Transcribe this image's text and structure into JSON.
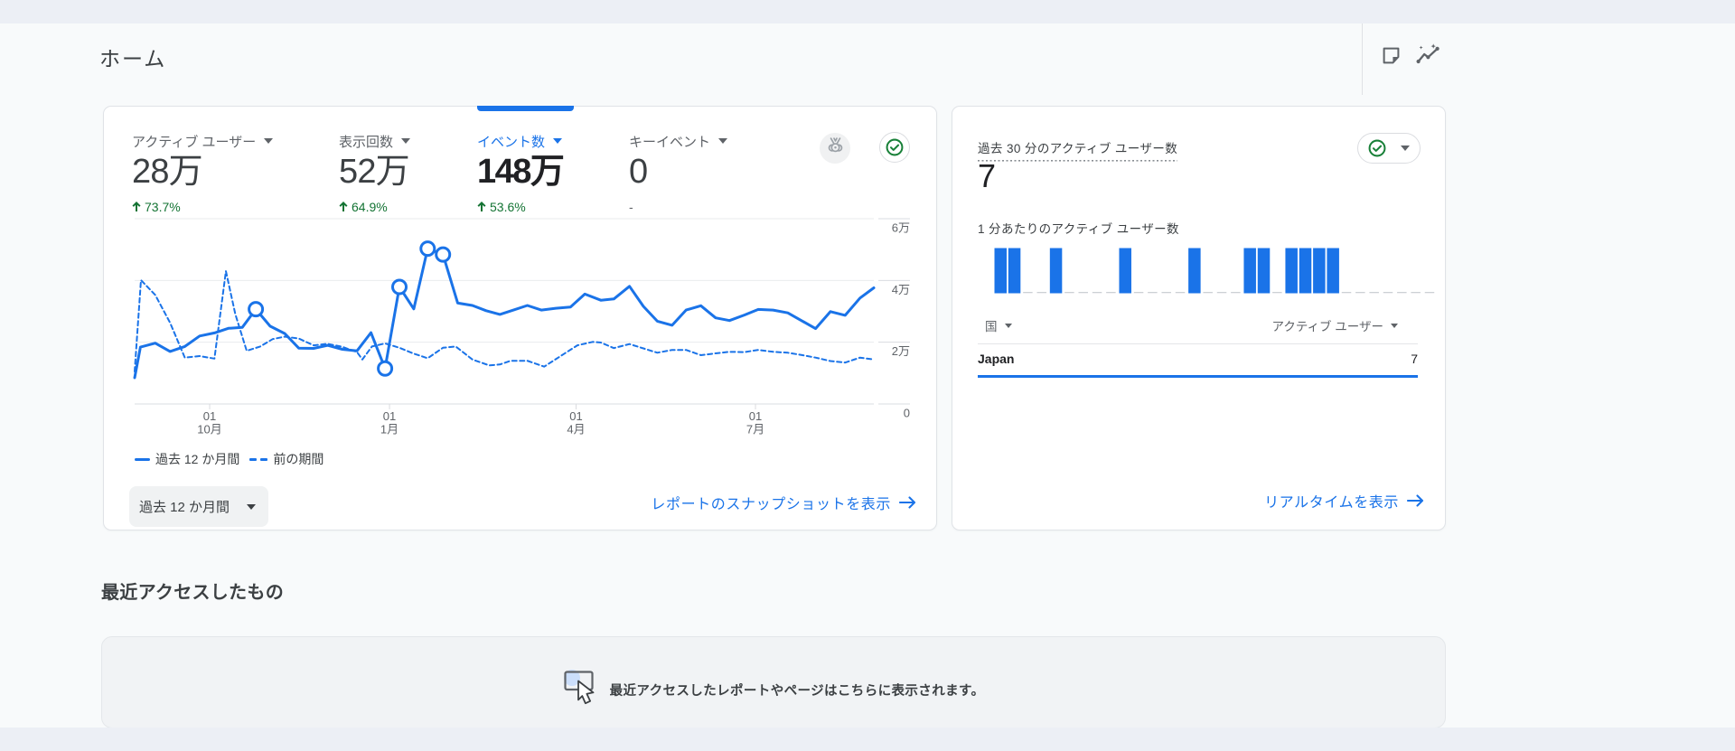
{
  "page": {
    "title": "ホーム"
  },
  "header": {
    "icons": [
      {
        "name": "note-icon"
      },
      {
        "name": "insights-icon"
      }
    ]
  },
  "overview_card": {
    "metrics": [
      {
        "label": "アクティブ ユーザー",
        "value": "28万",
        "delta": "73.7%",
        "delta_dir": "up",
        "selected": false
      },
      {
        "label": "表示回数",
        "value": "52万",
        "delta": "64.9%",
        "delta_dir": "up",
        "selected": false
      },
      {
        "label": "イベント数",
        "value": "148万",
        "delta": "53.6%",
        "delta_dir": "up",
        "selected": true
      },
      {
        "label": "キーイベント",
        "value": "0",
        "delta": "-",
        "delta_dir": "none",
        "selected": false
      }
    ],
    "legend": [
      {
        "label": "過去 12 か月間",
        "style": "solid"
      },
      {
        "label": "前の期間",
        "style": "dashed"
      }
    ],
    "range_button_label": "過去 12 か月間",
    "link_label": "レポートのスナップショットを表示",
    "chart_data": {
      "type": "line",
      "unit": "万",
      "ylim": [
        0,
        6
      ],
      "y_ticks": [
        {
          "value": 6,
          "label": "6万"
        },
        {
          "value": 4,
          "label": "4万"
        },
        {
          "value": 2,
          "label": "2万"
        },
        {
          "value": 0,
          "label": "0"
        }
      ],
      "x_ticks": [
        {
          "frac": 0.1015,
          "line1": "01",
          "line2": "10月"
        },
        {
          "frac": 0.3448,
          "line1": "01",
          "line2": "1月"
        },
        {
          "frac": 0.5972,
          "line1": "01",
          "line2": "4月"
        },
        {
          "frac": 0.8399,
          "line1": "01",
          "line2": "7月"
        }
      ],
      "series": [
        {
          "name": "過去 12 か月間",
          "style": "solid",
          "points": [
            [
              0.0,
              0.85
            ],
            [
              0.0078,
              1.84
            ],
            [
              0.0279,
              1.97
            ],
            [
              0.0479,
              1.7
            ],
            [
              0.0678,
              1.86
            ],
            [
              0.0879,
              2.2
            ],
            [
              0.108,
              2.3
            ],
            [
              0.1268,
              2.45
            ],
            [
              0.1456,
              2.48
            ],
            [
              0.1639,
              3.07
            ],
            [
              0.1832,
              2.52
            ],
            [
              0.2032,
              2.28
            ],
            [
              0.222,
              1.81
            ],
            [
              0.2421,
              1.8
            ],
            [
              0.2609,
              1.9
            ],
            [
              0.2809,
              1.77
            ],
            [
              0.3009,
              1.72
            ],
            [
              0.3197,
              2.31
            ],
            [
              0.3388,
              1.15
            ],
            [
              0.3582,
              3.79
            ],
            [
              0.3776,
              3.08
            ],
            [
              0.3965,
              5.03
            ],
            [
              0.4171,
              4.84
            ],
            [
              0.437,
              3.27
            ],
            [
              0.457,
              3.19
            ],
            [
              0.4755,
              3.02
            ],
            [
              0.4941,
              2.9
            ],
            [
              0.5134,
              3.05
            ],
            [
              0.5313,
              3.19
            ],
            [
              0.5501,
              3.04
            ],
            [
              0.5697,
              3.1
            ],
            [
              0.5896,
              3.14
            ],
            [
              0.609,
              3.56
            ],
            [
              0.6307,
              3.36
            ],
            [
              0.6483,
              3.4
            ],
            [
              0.6694,
              3.81
            ],
            [
              0.6883,
              3.16
            ],
            [
              0.7071,
              2.68
            ],
            [
              0.7271,
              2.55
            ],
            [
              0.746,
              3.04
            ],
            [
              0.766,
              3.18
            ],
            [
              0.7859,
              2.79
            ],
            [
              0.8048,
              2.7
            ],
            [
              0.8248,
              2.88
            ],
            [
              0.8436,
              3.06
            ],
            [
              0.8637,
              3.04
            ],
            [
              0.8836,
              2.95
            ],
            [
              0.9036,
              2.68
            ],
            [
              0.9212,
              2.44
            ],
            [
              0.9413,
              2.99
            ],
            [
              0.9612,
              2.87
            ],
            [
              0.9813,
              3.43
            ],
            [
              1.0,
              3.76
            ]
          ],
          "marker_indices": [
            9,
            18,
            19,
            21,
            22
          ]
        },
        {
          "name": "前の期間",
          "style": "dashed",
          "points": [
            [
              0.0,
              1.05
            ],
            [
              0.0086,
              4.01
            ],
            [
              0.0279,
              3.53
            ],
            [
              0.0479,
              2.63
            ],
            [
              0.0678,
              1.5
            ],
            [
              0.0879,
              1.55
            ],
            [
              0.108,
              1.47
            ],
            [
              0.1235,
              4.3
            ],
            [
              0.1362,
              2.91
            ],
            [
              0.1516,
              1.72
            ],
            [
              0.1699,
              1.86
            ],
            [
              0.1868,
              2.1
            ],
            [
              0.2032,
              2.18
            ],
            [
              0.222,
              2.12
            ],
            [
              0.2421,
              1.9
            ],
            [
              0.2609,
              1.95
            ],
            [
              0.2809,
              1.85
            ],
            [
              0.3009,
              1.68
            ],
            [
              0.3081,
              1.44
            ],
            [
              0.321,
              1.86
            ],
            [
              0.3388,
              1.96
            ],
            [
              0.3582,
              1.82
            ],
            [
              0.3776,
              1.63
            ],
            [
              0.3965,
              1.48
            ],
            [
              0.4171,
              1.82
            ],
            [
              0.4343,
              1.86
            ],
            [
              0.457,
              1.44
            ],
            [
              0.4796,
              1.25
            ],
            [
              0.4941,
              1.28
            ],
            [
              0.5087,
              1.4
            ],
            [
              0.5313,
              1.4
            ],
            [
              0.554,
              1.21
            ],
            [
              0.5795,
              1.6
            ],
            [
              0.599,
              1.9
            ],
            [
              0.6198,
              2.01
            ],
            [
              0.6307,
              1.99
            ],
            [
              0.6483,
              1.81
            ],
            [
              0.6694,
              1.94
            ],
            [
              0.6883,
              1.8
            ],
            [
              0.7071,
              1.66
            ],
            [
              0.7271,
              1.75
            ],
            [
              0.746,
              1.75
            ],
            [
              0.766,
              1.58
            ],
            [
              0.7859,
              1.64
            ],
            [
              0.8048,
              1.69
            ],
            [
              0.8248,
              1.68
            ],
            [
              0.8436,
              1.75
            ],
            [
              0.8637,
              1.69
            ],
            [
              0.8836,
              1.66
            ],
            [
              0.9036,
              1.58
            ],
            [
              0.9212,
              1.5
            ],
            [
              0.9413,
              1.39
            ],
            [
              0.9612,
              1.34
            ],
            [
              0.9813,
              1.5
            ],
            [
              1.0,
              1.44
            ]
          ],
          "marker_indices": []
        }
      ]
    }
  },
  "realtime_card": {
    "title": "過去 30 分のアクティブ ユーザー数",
    "value": "7",
    "per_minute_label": "1 分あたりのアクティブ ユーザー数",
    "dimension_header": "国",
    "metric_header": "アクティブ ユーザー",
    "rows": [
      {
        "country": "Japan",
        "value": "7"
      }
    ],
    "link_label": "リアルタイムを表示",
    "chart_data": {
      "type": "bar",
      "slots": 32,
      "active_minutes": [
        0,
        1,
        4,
        9,
        14,
        18,
        19,
        21,
        22,
        23,
        24
      ],
      "bar_value": 1
    }
  },
  "recent": {
    "heading": "最近アクセスしたもの",
    "empty_message": "最近アクセスしたレポートやページはこちらに表示されます。"
  },
  "colors": {
    "accent_blue": "#1a73e8",
    "delta_green": "#137333",
    "icon_green": "#188038",
    "text_dark": "#202124",
    "text_mid": "#3c4043",
    "text_gray": "#5f6368",
    "grid": "#e9ebee",
    "axis": "#dadce0"
  }
}
